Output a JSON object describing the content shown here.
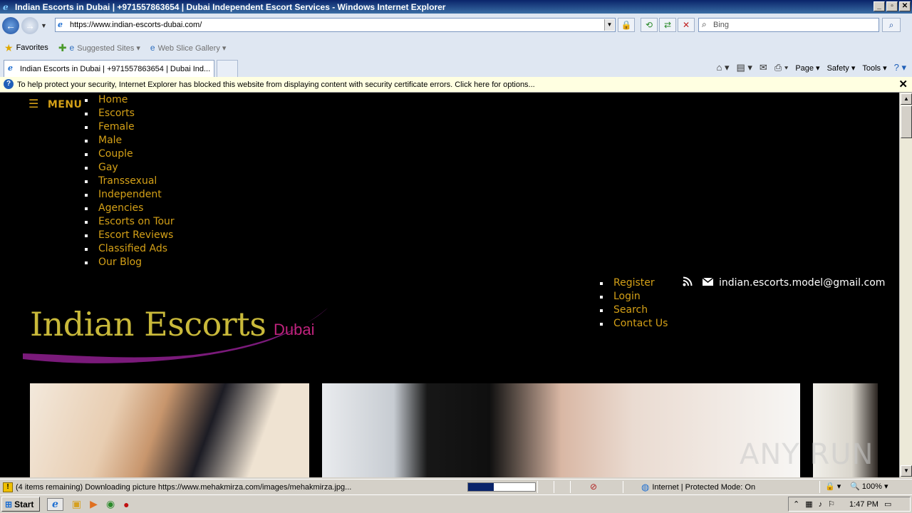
{
  "window": {
    "title": "Indian Escorts in Dubai  | +971557863654 | Dubai Independent Escort Services - Windows Internet Explorer",
    "controls": [
      "_",
      "▫",
      "✕"
    ]
  },
  "address": {
    "url": "https://www.indian-escorts-dubai.com/"
  },
  "search": {
    "placeholder": "Bing"
  },
  "favorites": {
    "label": "Favorites",
    "items": [
      "Suggested Sites ▾",
      "Web Slice Gallery ▾"
    ]
  },
  "tab": {
    "label": "Indian Escorts in Dubai  | +971557863654 | Dubai Ind..."
  },
  "command_bar": {
    "page": "Page ▾",
    "safety": "Safety ▾",
    "tools": "Tools ▾"
  },
  "infobar": {
    "message": "To help protect your security, Internet Explorer has blocked this website from displaying content with security certificate errors. Click here for options..."
  },
  "site": {
    "menu_label": "MENU",
    "main_nav": [
      "Home",
      "Escorts",
      "Female",
      "Male",
      "Couple",
      "Gay",
      "Transsexual",
      "Independent",
      "Agencies",
      "Escorts on Tour",
      "Escort Reviews",
      "Classified Ads",
      "Our Blog"
    ],
    "user_nav": [
      "Register",
      "Login",
      "Search",
      "Contact Us"
    ],
    "email": "indian.escorts.model@gmail.com",
    "logo_text": "Indian Escorts",
    "logo_sub": "Dubai",
    "watermark": "ANY RUN"
  },
  "status": {
    "text": "(4 items remaining) Downloading picture https://www.mehakmirza.com/images/mehakmirza.jpg...",
    "zone": "Internet | Protected Mode: On",
    "zoom": "100%",
    "progress": 0.38
  },
  "taskbar": {
    "start": "Start",
    "clock": "1:47 PM"
  },
  "colors": {
    "accent": "#d4a017",
    "logo": "#c9b93a",
    "logo_sub": "#c0237d",
    "swoosh": "#7a1a7a"
  }
}
